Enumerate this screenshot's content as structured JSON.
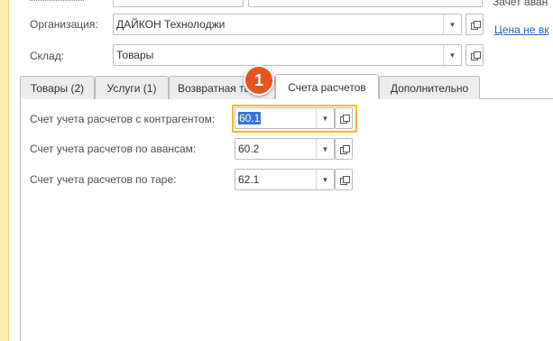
{
  "header": {
    "right_top_text": "Зачет аван",
    "right_link_text": "Цена не вк"
  },
  "form": {
    "organization": {
      "label": "Организация:",
      "value": "ДАЙКОН Технолоджи"
    },
    "warehouse": {
      "label": "Склад:",
      "value": "Товары"
    }
  },
  "tabs": [
    {
      "label": "Товары (2)",
      "active": false
    },
    {
      "label": "Услуги (1)",
      "active": false
    },
    {
      "label": "Возвратная тара",
      "active": false
    },
    {
      "label": "Счета расчетов",
      "active": true
    },
    {
      "label": "Дополнительно",
      "active": false
    }
  ],
  "accounts": {
    "contractor": {
      "label": "Счет учета расчетов с контрагентом:",
      "value": "60.1"
    },
    "advances": {
      "label": "Счет учета расчетов по авансам:",
      "value": "60.2"
    },
    "tare": {
      "label": "Счет учета расчетов по таре:",
      "value": "62.1"
    }
  },
  "callout": {
    "number": "1",
    "color": "#e8541e"
  },
  "colors": {
    "highlight": "#f2b928",
    "link": "#1a66c2",
    "left_strip": "#fbeeb0"
  }
}
